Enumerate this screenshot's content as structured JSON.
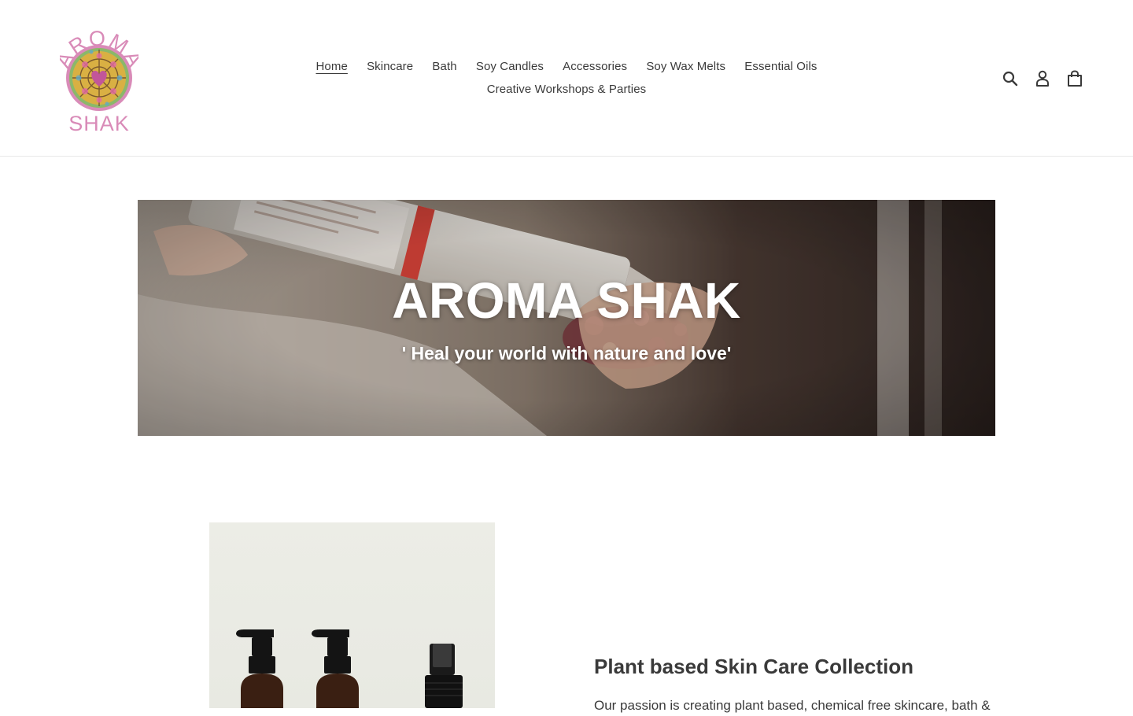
{
  "brand": {
    "logo_top": "AROMA",
    "logo_bottom": "SHAK",
    "colors": {
      "logo_pink": "#d98bb8",
      "heart": "#c2569a"
    }
  },
  "nav": {
    "items": [
      {
        "label": "Home",
        "active": true
      },
      {
        "label": "Skincare"
      },
      {
        "label": "Bath"
      },
      {
        "label": "Soy Candles"
      },
      {
        "label": "Accessories"
      },
      {
        "label": "Soy Wax Melts"
      },
      {
        "label": "Essential Oils"
      },
      {
        "label": "Creative Workshops & Parties"
      }
    ]
  },
  "header_icons": [
    "search-icon",
    "account-icon",
    "cart-icon"
  ],
  "hero": {
    "title": "AROMA SHAK",
    "subtitle": "' Heal your world with nature and love'"
  },
  "feature": {
    "title": "Plant based Skin Care Collection",
    "body": "Our passion is creating plant based, chemical free skincare, bath &"
  },
  "colors": {
    "text": "#3a3a3a",
    "border": "#e8e8e8",
    "hero_text": "#ffffff"
  }
}
